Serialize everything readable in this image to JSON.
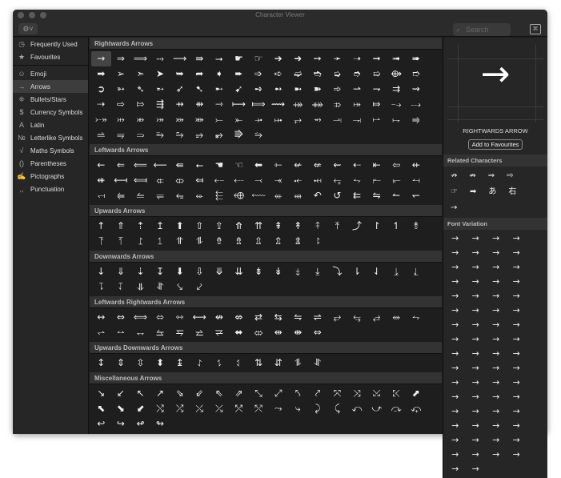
{
  "window": {
    "title": "Character Viewer"
  },
  "toolbar": {
    "gear": "⚙˅",
    "search_placeholder": "Search",
    "search_icon": "search-icon",
    "keyboard_icon": "⌘"
  },
  "sidebar": {
    "groups": [
      [
        {
          "icon": "◷",
          "label": "Frequently Used"
        },
        {
          "icon": "★",
          "label": "Favourites"
        }
      ],
      [
        {
          "icon": "☺",
          "label": "Emoji"
        },
        {
          "icon": "→",
          "label": "Arrows",
          "selected": true
        },
        {
          "icon": "⁜",
          "label": "Bullets/Stars"
        },
        {
          "icon": "$",
          "label": "Currency Symbols"
        },
        {
          "icon": "A",
          "label": "Latin"
        },
        {
          "icon": "№",
          "label": "Letterlike Symbols"
        },
        {
          "icon": "√",
          "label": "Maths Symbols"
        },
        {
          "icon": "()",
          "label": "Parentheses"
        },
        {
          "icon": "✍",
          "label": "Pictographs"
        },
        {
          "icon": ",,",
          "label": "Punctuation"
        }
      ]
    ]
  },
  "sections": [
    {
      "title": "Rightwards Arrows",
      "chars": "→⇒⟹⤑⟶⇛⭢☛☞➔➜➙➛➝➞➟➠➡➢➣➤➥➦➧➨➩➪➫➬➭➮➯⟴➱➲➳➴➵➶➷➸➹➺➻➼➽➾⇀⇁⇉⇝⇢⇨⇰⇶⇸⇻⇾⟼⟾⟿⤀⤁⤃⤅⤇⤍⤏⤐⤔⤕⤖⤗⤘⤚⤜⤞⤠⥅⥇⥓⥗⥛⥟⥤⥬⥭⥰⥱⥲⥴⥵⭆⭇"
    },
    {
      "title": "Leftwards Arrows",
      "chars": "←⇐⟸⟵⇚⭠☚☜⬅⇽↚⇍⇜⇠⇤⇦⇷⇺⟻⟽⤂⤄⤆⤌⤎⤙⤛⤝⤟⥆⥊⥒⥖⥚⥞⥢⥪⥫⥳⬰⬱⬲⬳⬴⬵↶↺⇇⇋↼↽"
    },
    {
      "title": "Upwards Arrows",
      "chars": "↑⇑⇡↥⬆⇧⇪⤊⇈⇞↟⤉⤒⤴↾↿⥉⥔⥘⥜⥠⥣⥮⇮⇯⇫⇬⇭⥏"
    },
    {
      "title": "Downwards Arrows",
      "chars": "↓⇓⇣↧⬇⇩⤋⇊⇟↡⤈⤓⤵⇂⇃⥕⥙⥝⥡⥥⥯⤥⤦"
    },
    {
      "title": "Leftwards Rightwards Arrows",
      "chars": "↔⇔⟺⬄⇿⟷↮⇎⇄⇆⇋⇌⥂⥃⥄⥈⥊⥋⥎⥐⥦⥧⥨⥩⬌⤄⇹⇼⇔"
    },
    {
      "title": "Upwards Downwards Arrows",
      "chars": "↕⇕⇳⬍↨⥌⥍⥑⇅⇵⥮⥯"
    },
    {
      "title": "Miscellaneous Arrows",
      "chars": "↘↙↖↗⇘⇙⇖⇗⤡⤢⤣⤤⤧⤨⤩⤪⬈⬉⬊⬋⤭⤮⤯⤰⤱⤲⤳⤷⤸⤹⤺⤻⤼⤽↩↪↫↬"
    }
  ],
  "selected_char": "→",
  "detail": {
    "name": "RIGHTWARDS ARROW",
    "add_button": "Add to Favourites"
  },
  "related": {
    "title": "Related Characters",
    "chars": "↛⇏⇒⇨☞➡あ右→"
  },
  "font_variation": {
    "title": "Font Variation",
    "chars": "→→→→→→→→→→→→→→→→→→→→→→→→→→→→→→→→→→→→→→→→→→→→→→→→→→→→→→→→→→→→→→→→→→"
  }
}
